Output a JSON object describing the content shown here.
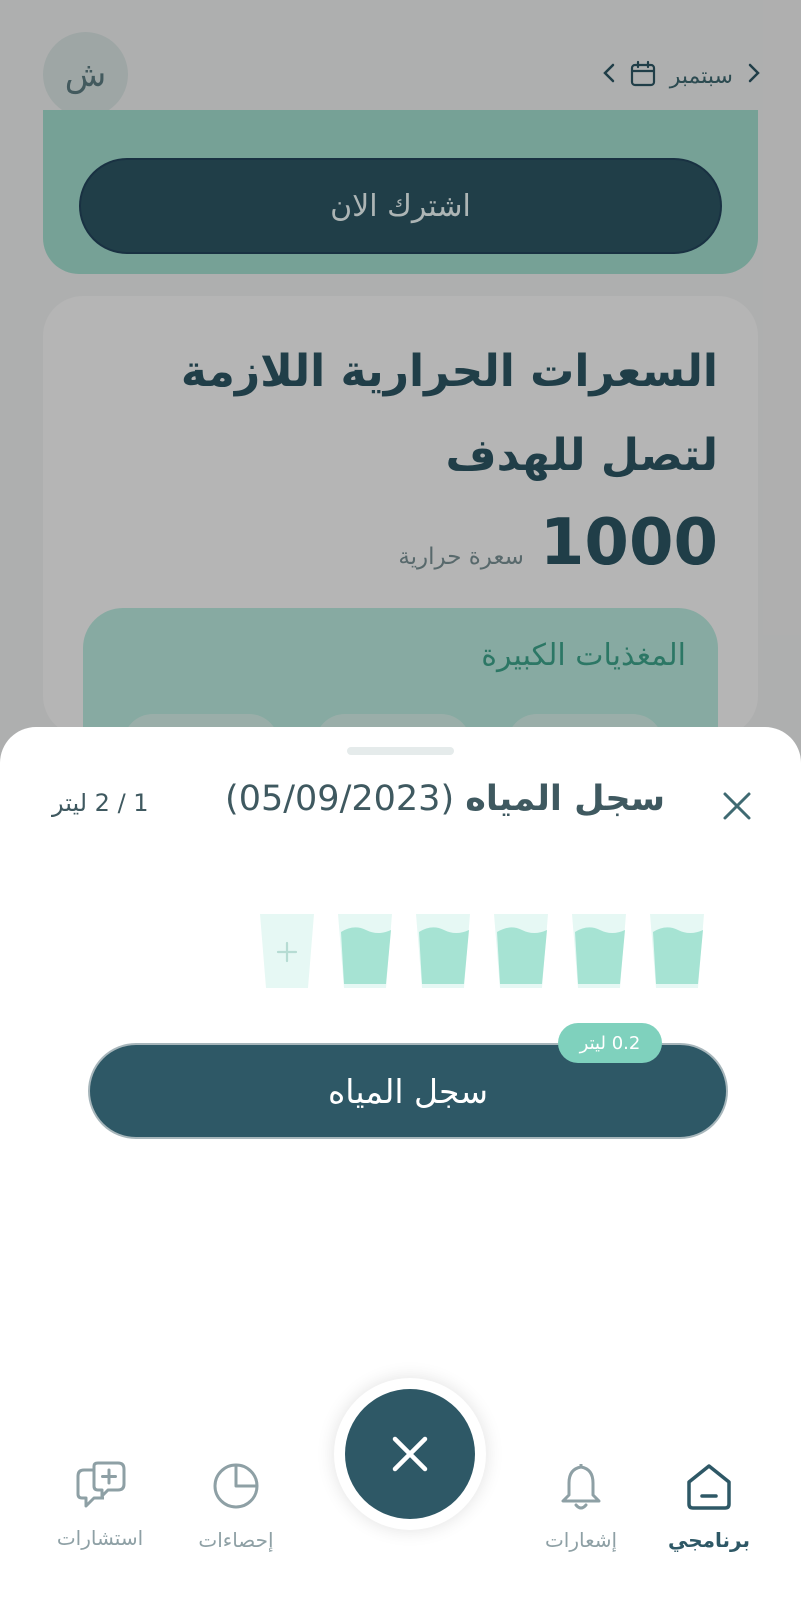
{
  "colors": {
    "primary": "#2e5866",
    "mint": "#a6e3d3",
    "mint_light": "#bff0e4",
    "water_fill": "#a6e3d3",
    "glass_empty": "#e6f8f4",
    "badge": "#7fd1bd",
    "muted_text": "#8ea0a5"
  },
  "topbar": {
    "avatar_letter": "ش",
    "month_label": "سبتمبر",
    "prev_icon": "chevron-right-icon",
    "next_icon": "chevron-left-icon",
    "calendar_icon": "calendar-icon"
  },
  "promo": {
    "subscribe_label": "اشترك الان"
  },
  "calories": {
    "title": "السعرات الحرارية اللازمة لتصل للهدف",
    "value": "1000",
    "unit": "سعرة حرارية"
  },
  "macros": {
    "title": "المغذيات الكبيرة"
  },
  "water_sheet": {
    "title": "سجل المياه",
    "date": "(05/09/2023)",
    "progress": "1 / 2 ليتر",
    "glasses_filled": 5,
    "glass_add_icon": "plus-icon",
    "log_button_label": "سجل المياه",
    "amount_badge": "0.2 ليتر",
    "close_icon": "close-icon"
  },
  "nav": {
    "items": [
      {
        "label": "برنامجي",
        "icon": "home-icon",
        "active": true
      },
      {
        "label": "إشعارات",
        "icon": "bell-icon",
        "active": false
      },
      {
        "label": "إحصاءات",
        "icon": "pie-chart-icon",
        "active": false
      },
      {
        "label": "استشارات",
        "icon": "chat-plus-icon",
        "active": false
      }
    ],
    "fab_icon": "close-icon"
  }
}
